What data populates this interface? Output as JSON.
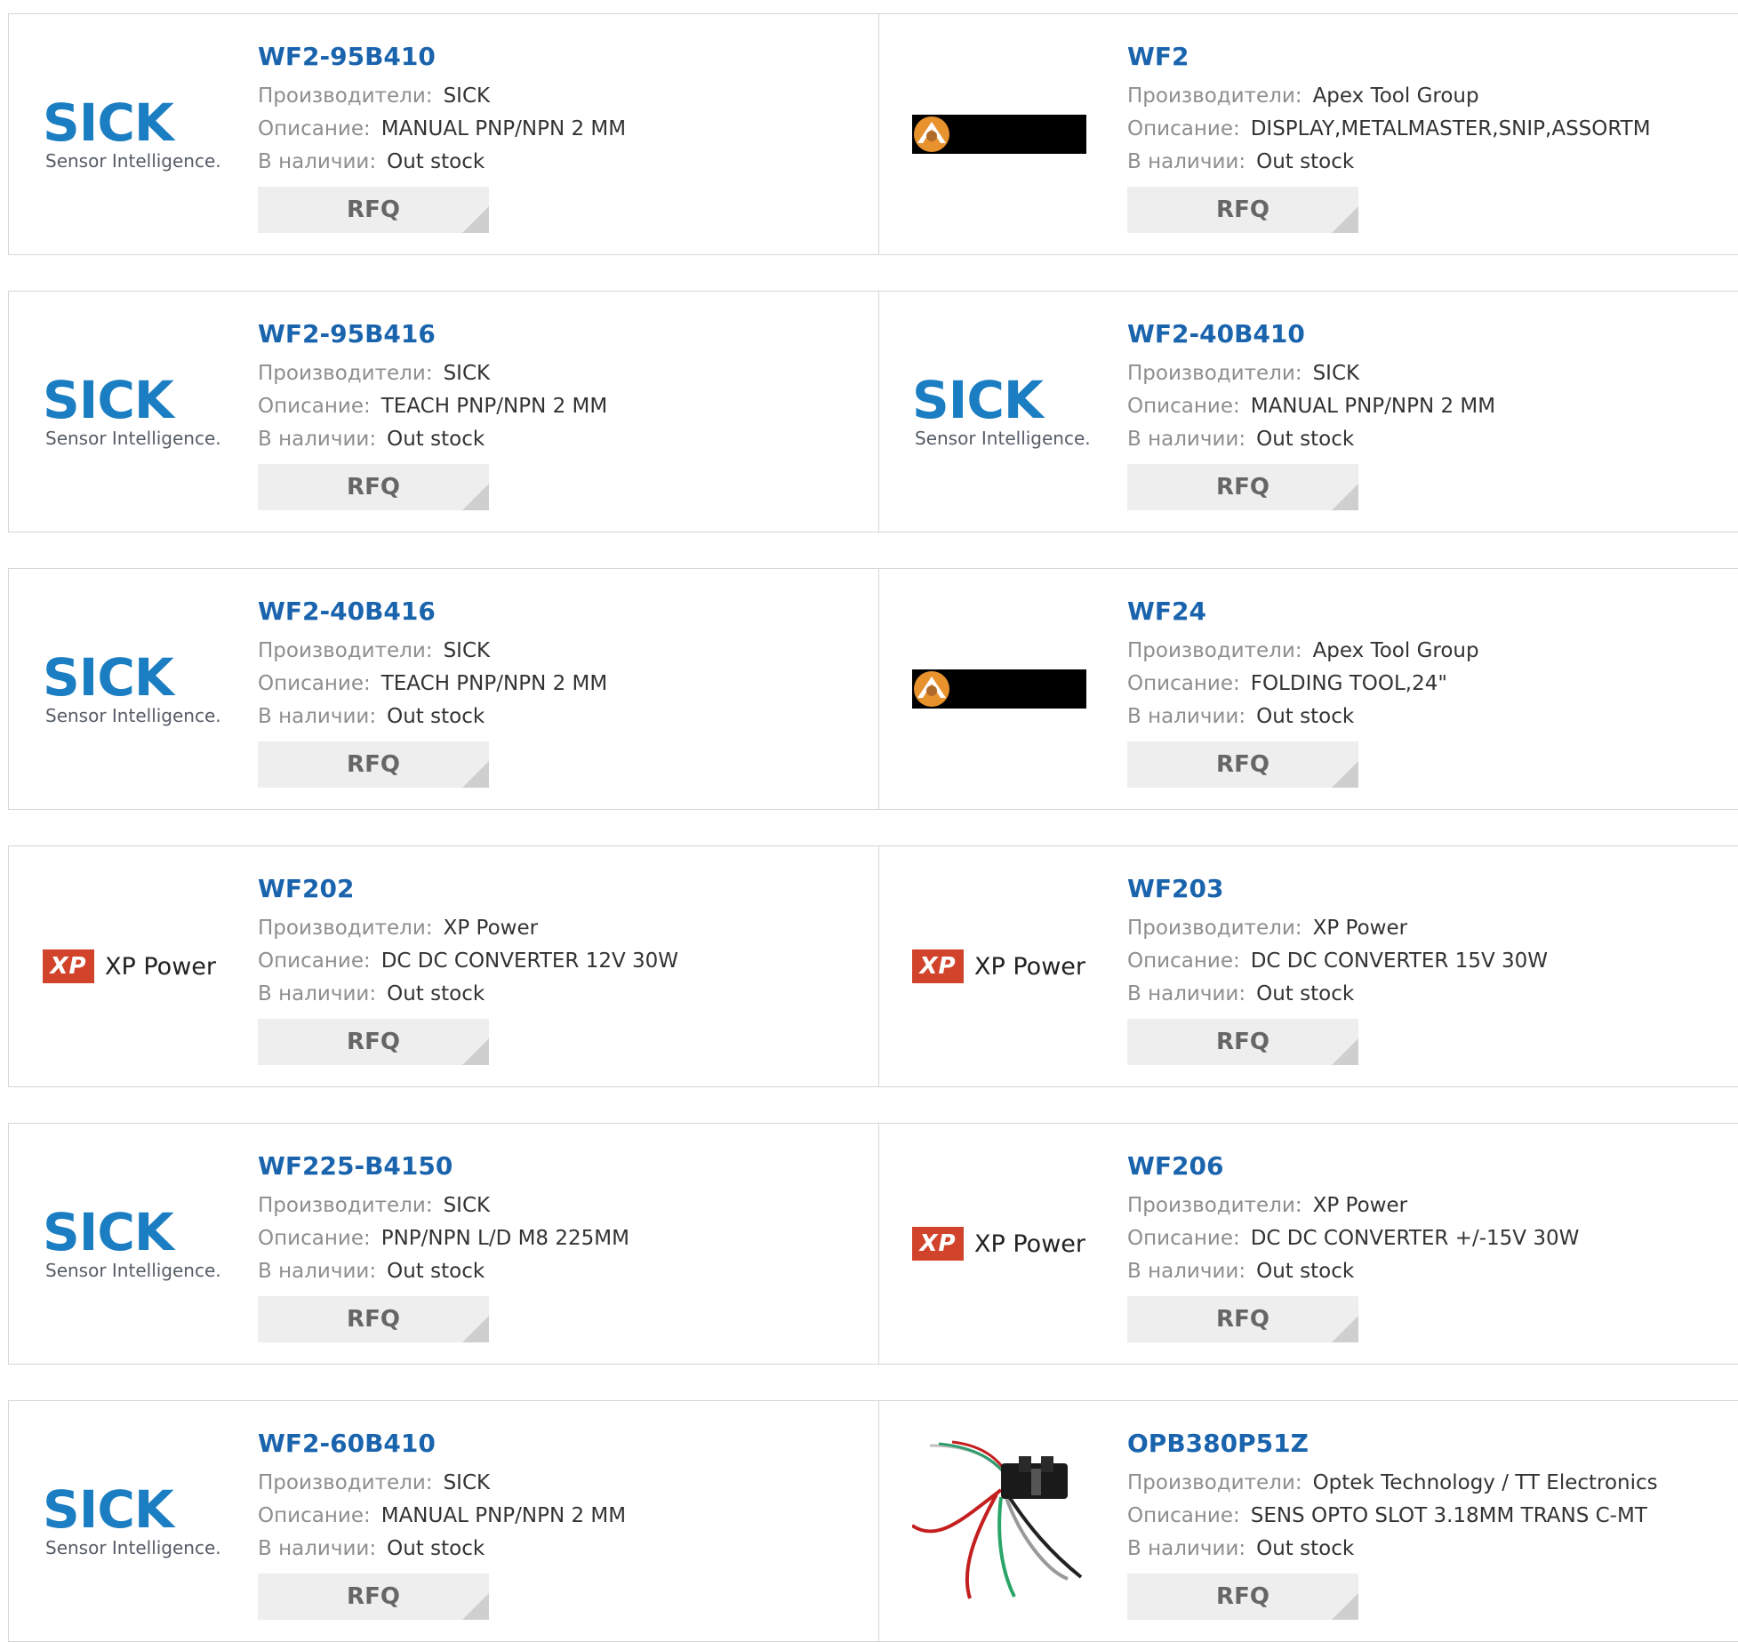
{
  "labels": {
    "manufacturer": "Производители:",
    "description": "Описание:",
    "stock": "В наличии:",
    "rfq": "RFQ"
  },
  "logos": {
    "sick_word": "SICK",
    "sick_sub": "Sensor Intelligence.",
    "xp_box": "XP",
    "xp_text": "XP Power"
  },
  "colors": {
    "link": "#1a64ad",
    "sick_blue": "#1c7ec2",
    "xp_red": "#d1442b"
  },
  "rows": [
    {
      "left": {
        "name": "WF2-95B410",
        "manufacturer": "SICK",
        "description": "MANUAL PNP/NPN 2 MM",
        "stock": "Out stock",
        "logo": "sick-logo"
      },
      "right": {
        "name": "WF2",
        "manufacturer": "Apex Tool Group",
        "description": "DISPLAY,METALMASTER,SNIP,ASSORTM",
        "stock": "Out stock",
        "logo": "apex-logo"
      }
    },
    {
      "left": {
        "name": "WF2-95B416",
        "manufacturer": "SICK",
        "description": "TEACH PNP/NPN 2 MM",
        "stock": "Out stock",
        "logo": "sick-logo"
      },
      "right": {
        "name": "WF2-40B410",
        "manufacturer": "SICK",
        "description": "MANUAL PNP/NPN 2 MM",
        "stock": "Out stock",
        "logo": "sick-logo"
      }
    },
    {
      "left": {
        "name": "WF2-40B416",
        "manufacturer": "SICK",
        "description": "TEACH PNP/NPN 2 MM",
        "stock": "Out stock",
        "logo": "sick-logo"
      },
      "right": {
        "name": "WF24",
        "manufacturer": "Apex Tool Group",
        "description": "FOLDING TOOL,24\"",
        "stock": "Out stock",
        "logo": "apex-logo"
      }
    },
    {
      "left": {
        "name": "WF202",
        "manufacturer": "XP Power",
        "description": "DC DC CONVERTER 12V 30W",
        "stock": "Out stock",
        "logo": "xp-logo"
      },
      "right": {
        "name": "WF203",
        "manufacturer": "XP Power",
        "description": "DC DC CONVERTER 15V 30W",
        "stock": "Out stock",
        "logo": "xp-logo"
      }
    },
    {
      "left": {
        "name": "WF225-B4150",
        "manufacturer": "SICK",
        "description": "PNP/NPN L/D M8 225MM",
        "stock": "Out stock",
        "logo": "sick-logo"
      },
      "right": {
        "name": "WF206",
        "manufacturer": "XP Power",
        "description": "DC DC CONVERTER +/-15V 30W",
        "stock": "Out stock",
        "logo": "xp-logo"
      }
    },
    {
      "left": {
        "name": "WF2-60B410",
        "manufacturer": "SICK",
        "description": "MANUAL PNP/NPN 2 MM",
        "stock": "Out stock",
        "logo": "sick-logo"
      },
      "right": {
        "name": "OPB380P51Z",
        "manufacturer": "Optek Technology / TT Electronics",
        "description": "SENS OPTO SLOT 3.18MM TRANS C-MT",
        "stock": "Out stock",
        "logo": "sensor-photo"
      }
    }
  ]
}
